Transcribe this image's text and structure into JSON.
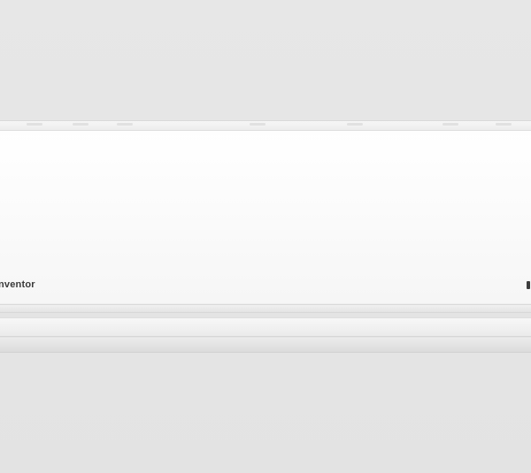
{
  "product": {
    "brand_text": "nventor",
    "type": "wall-mounted air conditioner indoor unit"
  },
  "colors": {
    "background": "#e5e5e5",
    "panel": "#ffffff",
    "brand_text": "#3a3a3a"
  }
}
